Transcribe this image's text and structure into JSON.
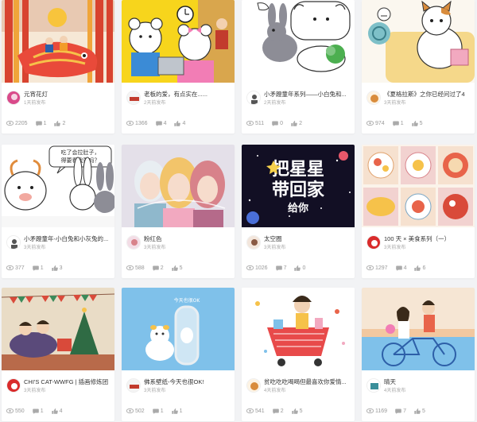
{
  "cards": [
    {
      "title": "元宵花灯",
      "time": "1天前发布",
      "views": "2205",
      "comments": "1",
      "likes": "2"
    },
    {
      "title": "老板的爱，有点实在......",
      "time": "2天前发布",
      "views": "1366",
      "comments": "4",
      "likes": "4"
    },
    {
      "title": "小矛蹬童年系列——小白兔和...",
      "time": "2天前发布",
      "views": "511",
      "comments": "0",
      "likes": "2"
    },
    {
      "title": "《夏格拉斯》之你已经问过了4",
      "time": "3天前发布",
      "views": "974",
      "comments": "1",
      "likes": "5"
    },
    {
      "title": "小矛蹬童年-小白兔和小灰兔的...",
      "time": "3天前发布",
      "views": "377",
      "comments": "1",
      "likes": "3"
    },
    {
      "title": "粉红色",
      "time": "3天前发布",
      "views": "588",
      "comments": "2",
      "likes": "5"
    },
    {
      "title": "太空圈",
      "time": "3天前发布",
      "views": "1026",
      "comments": "7",
      "likes": "0"
    },
    {
      "title": "100 天 × 美食系列（一）",
      "time": "3天前发布",
      "views": "1297",
      "comments": "4",
      "likes": "6"
    },
    {
      "title": "CHI'S CAT-WWFG | 插画修炼团",
      "time": "3天前发布",
      "views": "550",
      "comments": "1",
      "likes": "4"
    },
    {
      "title": "佛系壁纸-今天也很OK!",
      "time": "3天前发布",
      "views": "502",
      "comments": "1",
      "likes": "1"
    },
    {
      "title": "贫吃吃吃喝喝但最喜欢你爱情...",
      "time": "4天前发布",
      "views": "541",
      "comments": "2",
      "likes": "5"
    },
    {
      "title": "晴天",
      "time": "4天前发布",
      "views": "1169",
      "comments": "7",
      "likes": "5"
    }
  ],
  "artwork_text": {
    "card5_bubble": "吃了会拉肚子，\n得要看我要吗？",
    "card7_line1": "把星星",
    "card7_line2": "带回家",
    "card7_line3": "给你",
    "card10_mirror": "今天也很OK"
  },
  "icons": {
    "view": "eye-icon",
    "comment": "comment-icon",
    "like": "thumbs-up-icon"
  }
}
